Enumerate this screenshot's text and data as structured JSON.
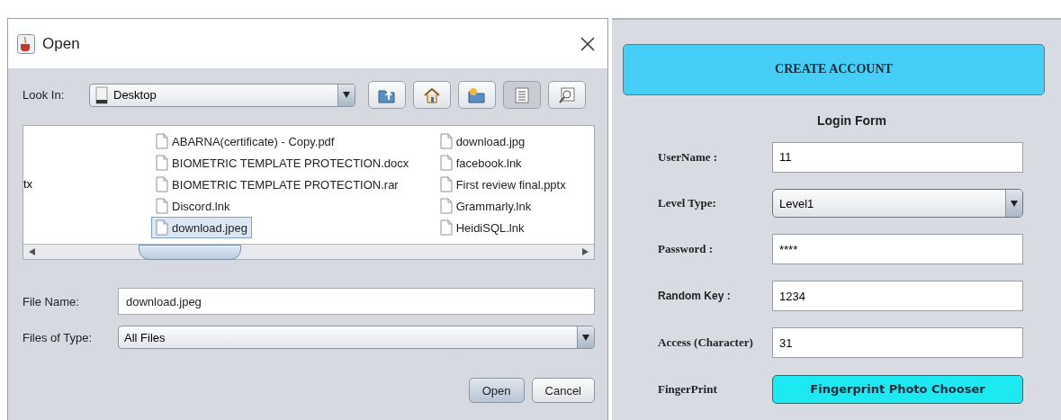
{
  "dialog": {
    "title": "Open",
    "look_in": {
      "label": "Look In:",
      "value": "Desktop"
    },
    "toolbar": [
      {
        "kind": "up",
        "selected": false
      },
      {
        "kind": "home",
        "selected": false
      },
      {
        "kind": "newfolder",
        "selected": false
      },
      {
        "kind": "list",
        "selected": true
      },
      {
        "kind": "details",
        "selected": false
      }
    ],
    "files": {
      "cut_column": [
        "tx"
      ],
      "columns": [
        [
          {
            "name": "ABARNA(certificate) - Copy.pdf",
            "selected": false
          },
          {
            "name": "BIOMETRIC TEMPLATE PROTECTION.docx",
            "selected": false
          },
          {
            "name": "BIOMETRIC TEMPLATE PROTECTION.rar",
            "selected": false
          },
          {
            "name": "Discord.lnk",
            "selected": false
          },
          {
            "name": "download.jpeg",
            "selected": true
          }
        ],
        [
          {
            "name": "download.jpg",
            "selected": false
          },
          {
            "name": "facebook.lnk",
            "selected": false
          },
          {
            "name": "First review final.pptx",
            "selected": false
          },
          {
            "name": "Grammarly.lnk",
            "selected": false
          },
          {
            "name": "HeidiSQL.lnk",
            "selected": false
          }
        ]
      ]
    },
    "file_name": {
      "label": "File Name:",
      "value": "download.jpeg"
    },
    "files_of_type": {
      "label": "Files of Type:",
      "value": "All Files"
    },
    "buttons": [
      {
        "label": "Open",
        "kind": "default"
      },
      {
        "label": "Cancel",
        "kind": "normal"
      }
    ]
  },
  "form": {
    "create_button": "CREATE ACCOUNT",
    "title": "Login Form",
    "fields": [
      {
        "label": "UserName :",
        "kind": "text",
        "value": "11"
      },
      {
        "label": "Level Type:",
        "kind": "select",
        "value": "Level1"
      },
      {
        "label": "Password :",
        "kind": "text",
        "value": "****"
      },
      {
        "label": "Random Key :",
        "kind": "text",
        "value": "1234"
      },
      {
        "label": "Access (Character)",
        "kind": "text",
        "value": "31"
      },
      {
        "label": "FingerPrint",
        "kind": "button",
        "value": "Fingerprint Photo Chooser"
      }
    ]
  }
}
